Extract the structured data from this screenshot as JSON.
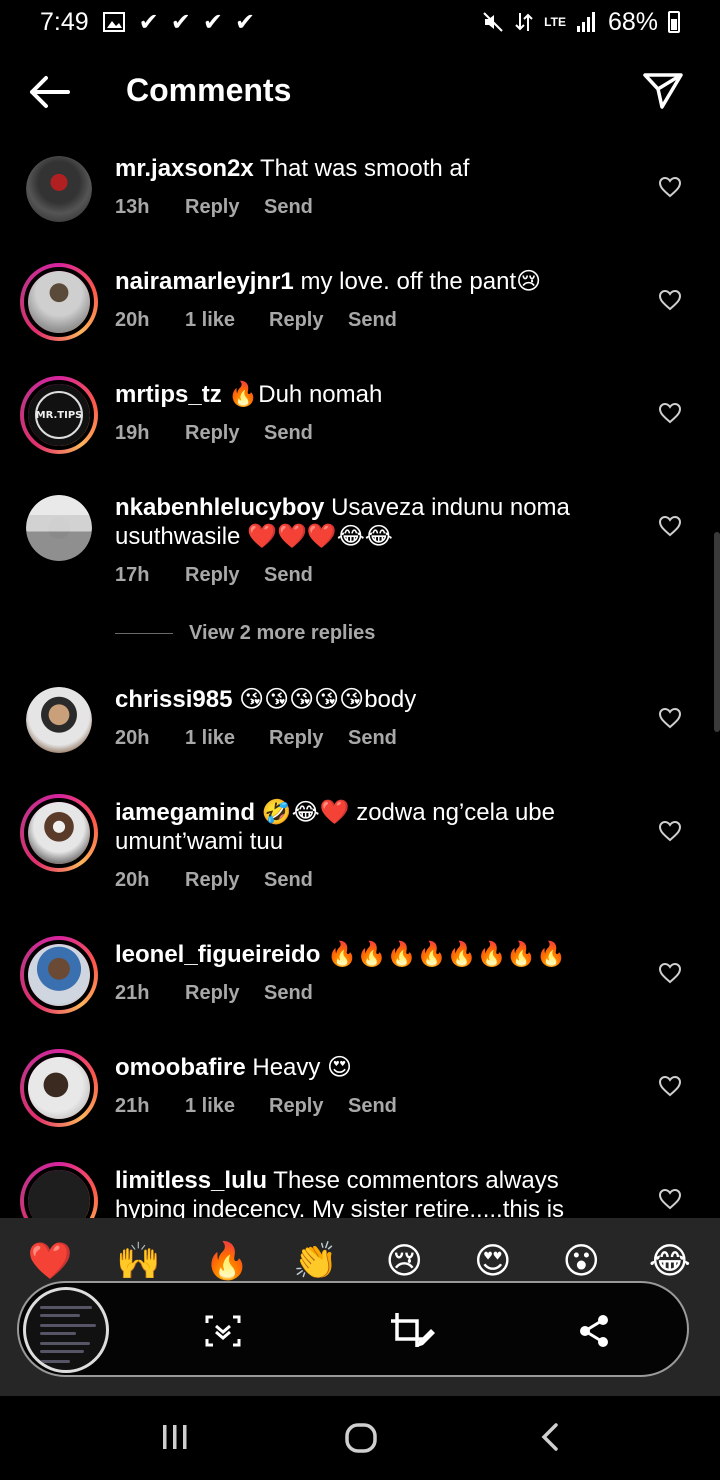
{
  "status_bar": {
    "time": "7:49",
    "battery": "68%",
    "lte": "LTE"
  },
  "header": {
    "title": "Comments"
  },
  "comments": [
    {
      "username": "mr.jaxson2x",
      "text": "That was smooth af",
      "time": "13h",
      "likes": "",
      "reply": "Reply",
      "send": "Send"
    },
    {
      "username": "nairamarleyjnr1",
      "text": "my love. off the pant😢",
      "time": "20h",
      "likes": "1 like",
      "reply": "Reply",
      "send": "Send"
    },
    {
      "username": "mrtips_tz",
      "text": "🔥Duh nomah",
      "time": "19h",
      "likes": "",
      "reply": "Reply",
      "send": "Send"
    },
    {
      "username": "nkabenhlelucyboy",
      "text": "Usaveza indunu noma usuthwasile ❤️❤️❤️😂😂",
      "time": "17h",
      "likes": "",
      "reply": "Reply",
      "send": "Send"
    },
    {
      "username": "chrissi985",
      "text": "😘😘😘😘😘body",
      "time": "20h",
      "likes": "1 like",
      "reply": "Reply",
      "send": "Send"
    },
    {
      "username": "iamegamind",
      "text": "🤣😂❤️ zodwa ng’cela ube umunt’wami tuu",
      "time": "20h",
      "likes": "",
      "reply": "Reply",
      "send": "Send"
    },
    {
      "username": "leonel_figueireido",
      "text": "🔥🔥🔥🔥🔥🔥🔥🔥",
      "time": "21h",
      "likes": "",
      "reply": "Reply",
      "send": "Send"
    },
    {
      "username": "omoobafire",
      "text": "Heavy 😍",
      "time": "21h",
      "likes": "1 like",
      "reply": "Reply",
      "send": "Send"
    },
    {
      "username": "limitless_lulu",
      "text": "These commentors always hyping indecency. My sister retire.....this is",
      "time": "",
      "likes": "",
      "reply": "",
      "send": ""
    }
  ],
  "view_replies": "View 2 more replies",
  "avatar_badge_text": "MR.TIPS",
  "emoji_reactions": [
    "❤️",
    "🙌",
    "🔥",
    "👏",
    "😢",
    "😍",
    "😮",
    "😂"
  ],
  "colors": {
    "background": "#000000",
    "meta_text": "#a8a8a8",
    "emoji_bar": "#262626",
    "heart_red": "#ed4956"
  }
}
